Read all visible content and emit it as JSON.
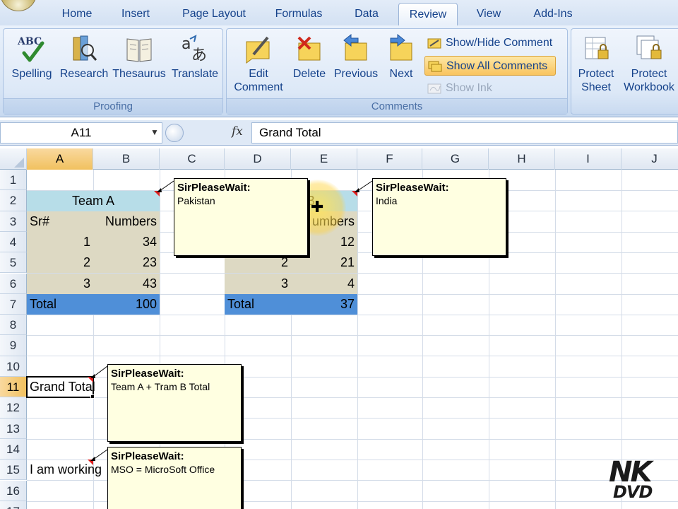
{
  "ribbon": {
    "tabs": [
      {
        "label": "Home"
      },
      {
        "label": "Insert"
      },
      {
        "label": "Page Layout"
      },
      {
        "label": "Formulas"
      },
      {
        "label": "Data"
      },
      {
        "label": "Review"
      },
      {
        "label": "View"
      },
      {
        "label": "Add-Ins"
      }
    ],
    "active_tab": "Review",
    "proofing": {
      "label": "Proofing",
      "spelling": "Spelling",
      "spelling_icon_text": "ABC",
      "research": "Research",
      "thesaurus": "Thesaurus",
      "translate": "Translate"
    },
    "comments": {
      "label": "Comments",
      "edit_line1": "Edit",
      "edit_line2": "Comment",
      "delete": "Delete",
      "previous": "Previous",
      "next": "Next",
      "show_hide": "Show/Hide Comment",
      "show_all": "Show All Comments",
      "show_ink": "Show Ink"
    },
    "protect": {
      "sheet_line1": "Protect",
      "sheet_line2": "Sheet",
      "workbook_line1": "Protect",
      "workbook_line2": "Workbook"
    }
  },
  "formula_bar": {
    "name_box": "A11",
    "fx": "fx",
    "value": "Grand Total"
  },
  "sheet": {
    "columns": [
      "A",
      "B",
      "C",
      "D",
      "E",
      "F",
      "G",
      "H",
      "I",
      "J"
    ],
    "rows": [
      "1",
      "2",
      "3",
      "4",
      "5",
      "6",
      "7",
      "8",
      "9",
      "10",
      "11",
      "12",
      "13",
      "14",
      "15",
      "16",
      "17"
    ],
    "selected_cell": "A11",
    "team_a": {
      "title": "Team A",
      "header_sr": "Sr#",
      "header_numbers": "Numbers",
      "rows": [
        {
          "sr": "1",
          "num": "34"
        },
        {
          "sr": "2",
          "num": "23"
        },
        {
          "sr": "3",
          "num": "43"
        }
      ],
      "total_label": "Total",
      "total_value": "100"
    },
    "team_b": {
      "title_fragment": "B",
      "header_numbers_fragment": "umbers",
      "rows": [
        {
          "sr": "2",
          "num": "21"
        },
        {
          "sr": "3",
          "num": "4"
        }
      ],
      "row1_num": "12",
      "total_label": "Total",
      "total_value": "37"
    },
    "a11": "Grand Total",
    "a15": "I am working"
  },
  "comments_boxes": [
    {
      "author": "SirPleaseWait:",
      "text": "Pakistan"
    },
    {
      "author": "SirPleaseWait:",
      "text": "India"
    },
    {
      "author": "SirPleaseWait:",
      "text": "Team A + Tram B Total"
    },
    {
      "author": "SirPleaseWait:",
      "text": "MSO = MicroSoft Office"
    }
  ],
  "colors": {
    "header_fill": "#b7dde8",
    "body_fill": "#ddd9c3",
    "total_fill": "#4f8fd8",
    "comment_bg": "#ffffe1",
    "indicator": "#e02020",
    "ribbon_text": "#15428b"
  },
  "watermark": {
    "line1": "NK",
    "line2": "DVD"
  }
}
